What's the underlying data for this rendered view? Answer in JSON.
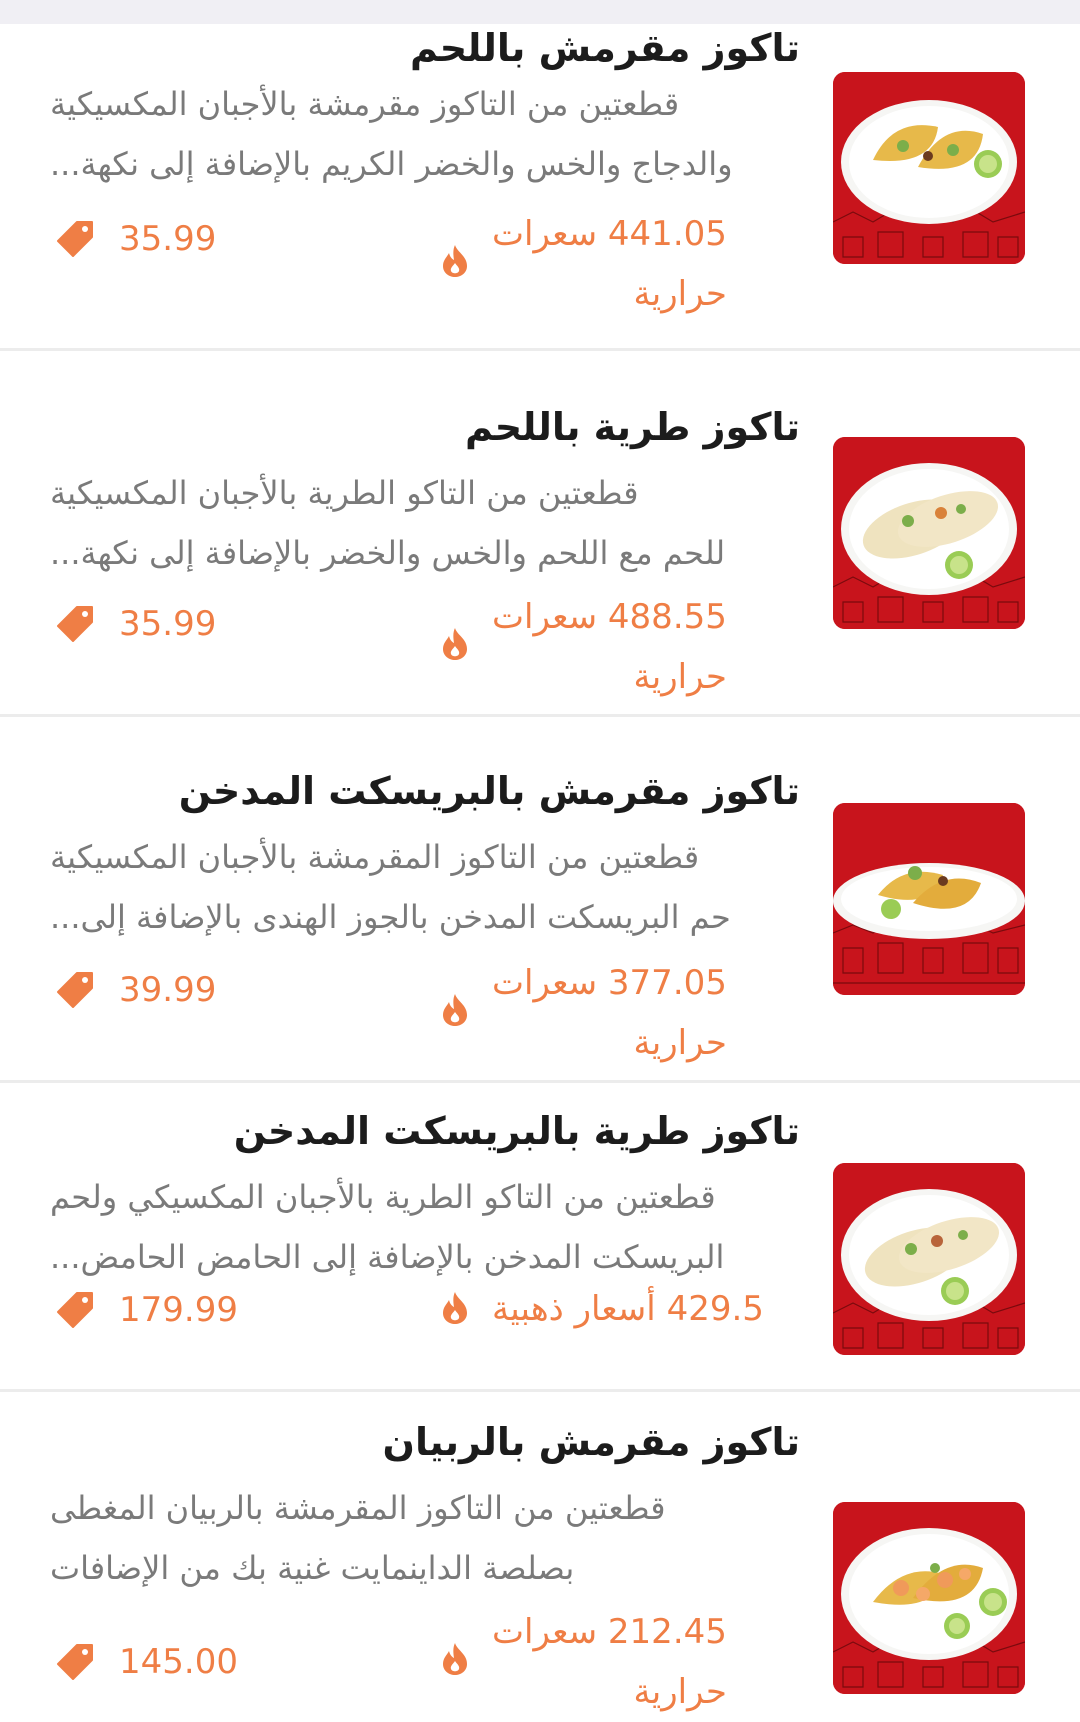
{
  "colors": {
    "accent": "#ef7e45",
    "title": "#1c1c1c",
    "description": "#7a7a7a",
    "thumbnail_bg": "#c8141c"
  },
  "items": [
    {
      "title": "تاكوز مقرمش باللحم",
      "desc_line1": "قطعتين من التاكوز مقرمشة بالأجبان المكسيكية",
      "desc_line2": "والدجاج والخس والخضر الكريم بالإضافة إلى نكهة...",
      "price": "35.99",
      "cal_line1": "441.05 سعرات",
      "cal_line2": "حرارية",
      "image_icon": "crispy-taco-plate"
    },
    {
      "title": "تاكوز طرية باللحم",
      "desc_line1": "قطعتين من التاكو الطرية بالأجبان المكسيكية",
      "desc_line2": "للحم مع اللحم والخس والخضر بالإضافة إلى نكهة...",
      "price": "35.99",
      "cal_line1": "488.55 سعرات",
      "cal_line2": "حرارية",
      "image_icon": "soft-taco-plate"
    },
    {
      "title": "تاكوز مقرمش بالبريسكت المدخن",
      "desc_line1": "قطعتين من التاكوز المقرمشة بالأجبان المكسيكية",
      "desc_line2": "حم البريسكت المدخن بالجوز الهندى بالإضافة إلى...",
      "price": "39.99",
      "cal_line1": "377.05 سعرات",
      "cal_line2": "حرارية",
      "image_icon": "crispy-brisket-taco-plate"
    },
    {
      "title": "تاكوز طرية بالبريسكت المدخن",
      "desc_line1": "قطعتين من التاكو الطرية بالأجبان المكسيكي ولحم",
      "desc_line2": "البريسكت المدخن بالإضافة إلى الحامض الحامض...",
      "price": "179.99",
      "cal_line1": "429.5 أسعار ذهبية",
      "cal_line2": "",
      "image_icon": "soft-brisket-taco-plate"
    },
    {
      "title": "تاكوز مقرمش بالربيان",
      "desc_line1": "قطعتين من التاكوز المقرمشة بالربيان المغطى",
      "desc_line2": "بصلصة الداينمايت غنية بك من الإضافات",
      "price": "145.00",
      "cal_line1": "212.45 سعرات",
      "cal_line2": "حرارية",
      "image_icon": "shrimp-taco-plate"
    }
  ]
}
